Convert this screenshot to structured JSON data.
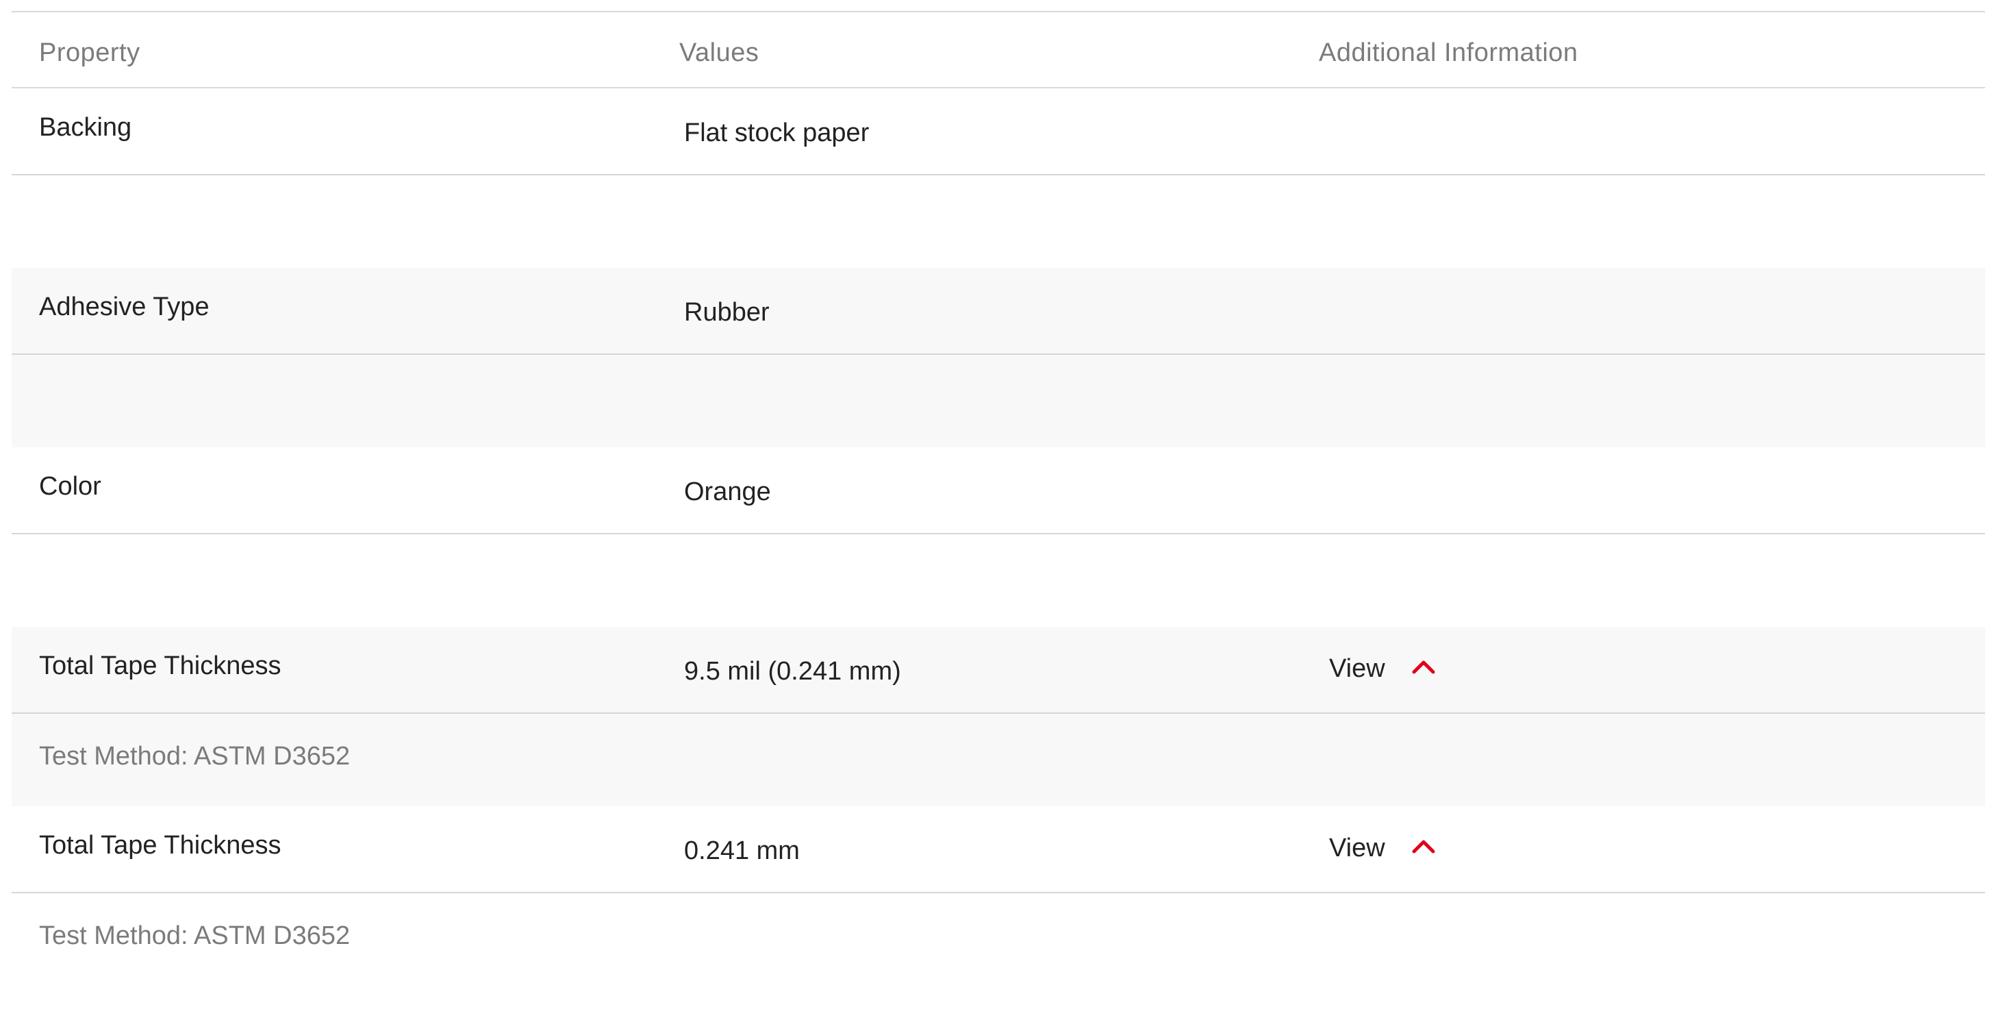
{
  "table": {
    "headers": {
      "property": "Property",
      "values": "Values",
      "additional": "Additional Information"
    },
    "rows": [
      {
        "property": "Backing",
        "value": "Flat stock paper"
      },
      {
        "property": "Adhesive Type",
        "value": "Rubber"
      },
      {
        "property": "Color",
        "value": "Orange"
      },
      {
        "property": "Total Tape Thickness",
        "value": "9.5 mil (0.241 mm)",
        "view_label": "View",
        "detail": "Test Method: ASTM D3652"
      },
      {
        "property": "Total Tape Thickness",
        "value": "0.241 mm",
        "view_label": "View",
        "detail": "Test Method: ASTM D3652"
      }
    ]
  },
  "icons": {
    "expand_toggle": "chevron-up-icon"
  },
  "colors": {
    "accent": "#e1001a",
    "row_shade": "#f8f8f8",
    "divider": "#d6d6d6",
    "muted_text": "#7b7b7b"
  }
}
